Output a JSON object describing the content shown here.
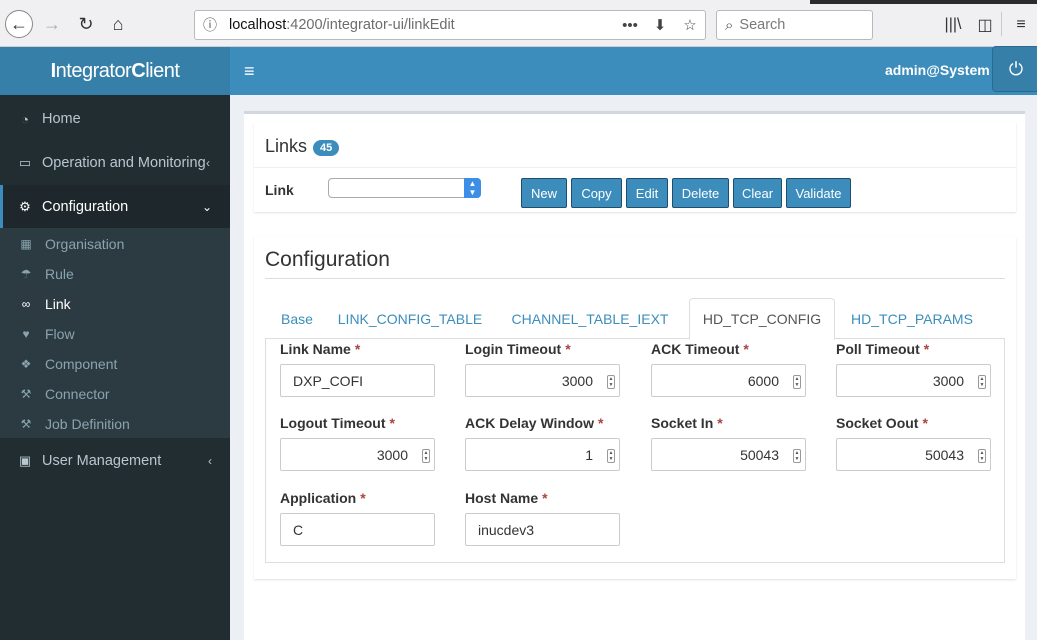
{
  "browser": {
    "url_host": "localhost",
    "url_path": ":4200/integrator-ui/linkEdit",
    "search_placeholder": "Search",
    "more_icon": "•••",
    "back_icon": "←",
    "forward_icon": "→",
    "reload_icon": "↻",
    "home_icon": "⌂",
    "info_icon": "ⓘ",
    "pocket_icon": "⬇",
    "star_icon": "☆",
    "search_icon": "⌕",
    "library_icon": "|||\\",
    "sidebar_icon": "◫",
    "menu_icon": "≡"
  },
  "header": {
    "logo_bold1": "I",
    "logo_part1": "ntegrator",
    "logo_bold2": "C",
    "logo_part2": "lient",
    "hamburger_icon": "≡",
    "user": "admin@System",
    "power_icon": "⏻"
  },
  "sidebar": {
    "home": {
      "label": "Home",
      "icon": "◔"
    },
    "operation": {
      "label": "Operation and Monitoring",
      "icon": "▭",
      "chevron": "‹"
    },
    "configuration": {
      "label": "Configuration",
      "icon": "⚙",
      "chevron": "⌄"
    },
    "sub": [
      {
        "label": "Organisation",
        "icon": "▦"
      },
      {
        "label": "Rule",
        "icon": "☂"
      },
      {
        "label": "Link",
        "icon": "∞"
      },
      {
        "label": "Flow",
        "icon": "♥"
      },
      {
        "label": "Component",
        "icon": "❖"
      },
      {
        "label": "Connector",
        "icon": "⚒"
      },
      {
        "label": "Job Definition",
        "icon": "⚒"
      }
    ],
    "user_mgmt": {
      "label": "User Management",
      "icon": "▣",
      "chevron": "‹"
    }
  },
  "links": {
    "title": "Links",
    "count": "45",
    "link_label": "Link",
    "select_value": "",
    "buttons": {
      "new": "New",
      "copy": "Copy",
      "edit": "Edit",
      "delete": "Delete",
      "clear": "Clear",
      "validate": "Validate"
    }
  },
  "config": {
    "title": "Configuration",
    "tabs": [
      "Base",
      "LINK_CONFIG_TABLE",
      "CHANNEL_TABLE_IEXT",
      "HD_TCP_CONFIG",
      "HD_TCP_PARAMS"
    ],
    "active_tab": "HD_TCP_CONFIG",
    "required_mark": "*",
    "fields": {
      "link_name": {
        "label": "Link Name",
        "value": "DXP_COFI"
      },
      "login_timeout": {
        "label": "Login Timeout",
        "value": "3000"
      },
      "ack_timeout": {
        "label": "ACK Timeout",
        "value": "6000"
      },
      "poll_timeout": {
        "label": "Poll Timeout",
        "value": "3000"
      },
      "logout_timeout": {
        "label": "Logout Timeout",
        "value": "3000"
      },
      "ack_delay_window": {
        "label": "ACK Delay Window",
        "value": "1"
      },
      "socket_in": {
        "label": "Socket In",
        "value": "50043"
      },
      "socket_oout": {
        "label": "Socket Oout",
        "value": "50043"
      },
      "application": {
        "label": "Application",
        "value": "C"
      },
      "host_name": {
        "label": "Host Name",
        "value": "inucdev3"
      }
    }
  }
}
